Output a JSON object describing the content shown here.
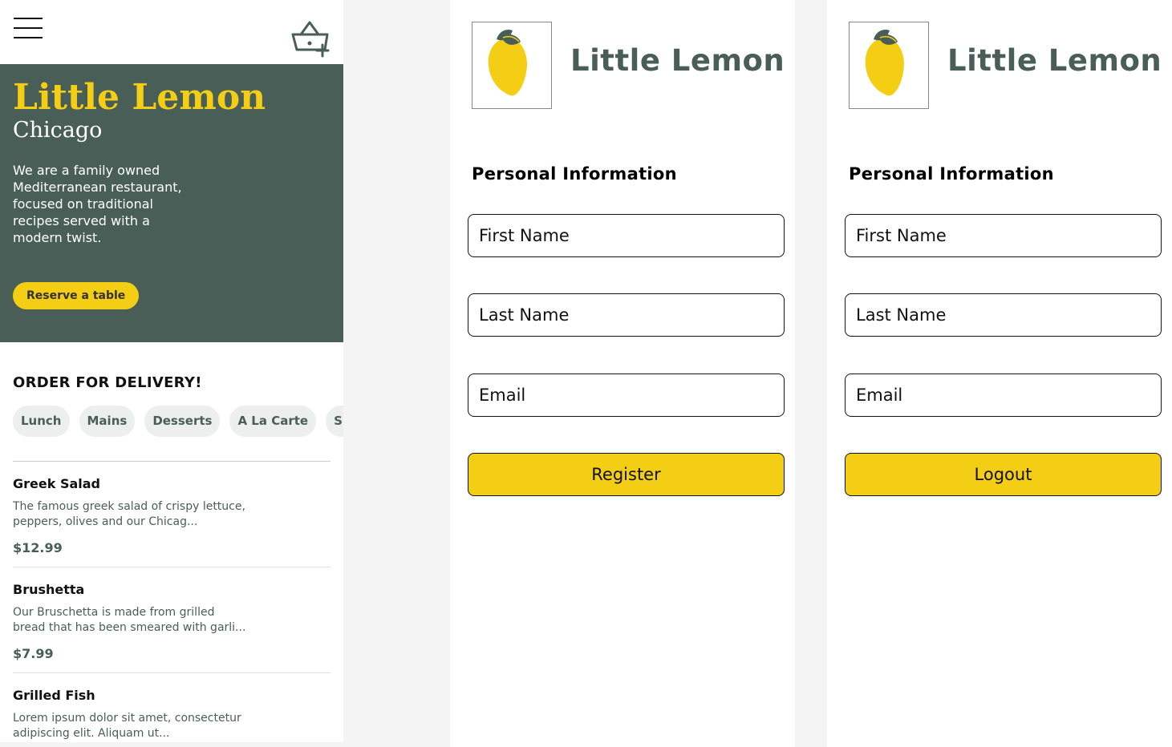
{
  "home": {
    "menu_icon": "hamburger-menu-icon",
    "cart_icon": "basket-add-icon",
    "hero": {
      "title": "Little Lemon",
      "subtitle": "Chicago",
      "description": "We are a family owned Mediterranean restaurant, focused on traditional recipes served with a modern twist.",
      "reserve_label": "Reserve a table"
    },
    "order_title": "ORDER FOR DELIVERY!",
    "categories": [
      "Lunch",
      "Mains",
      "Desserts",
      "A La Carte",
      "Specials"
    ],
    "menu_items": [
      {
        "name": "Greek Salad",
        "description": "The famous greek salad of crispy lettuce, peppers, olives and our Chicag...",
        "price": "$12.99"
      },
      {
        "name": "Brushetta",
        "description": "Our Bruschetta is made from grilled bread that has been smeared with garli...",
        "price": "$7.99"
      },
      {
        "name": "Grilled Fish",
        "description": "Lorem ipsum dolor sit amet, consectetur adipiscing elit. Aliquam ut...",
        "price": ""
      }
    ]
  },
  "register": {
    "brand": "Little Lemon",
    "logo_icon": "lemon-logo-icon",
    "section_title": "Personal Information",
    "first_name_placeholder": "First Name",
    "last_name_placeholder": "Last Name",
    "email_placeholder": "Email",
    "button_label": "Register"
  },
  "profile": {
    "brand": "Little Lemon",
    "logo_icon": "lemon-logo-icon",
    "section_title": "Personal Information",
    "first_name_placeholder": "First Name",
    "last_name_placeholder": "Last Name",
    "email_placeholder": "Email",
    "button_label": "Logout"
  },
  "colors": {
    "primary_green": "#495e57",
    "primary_yellow": "#f4ce14",
    "chip_bg": "#edefee",
    "canvas_bg": "#f4f4f4"
  }
}
